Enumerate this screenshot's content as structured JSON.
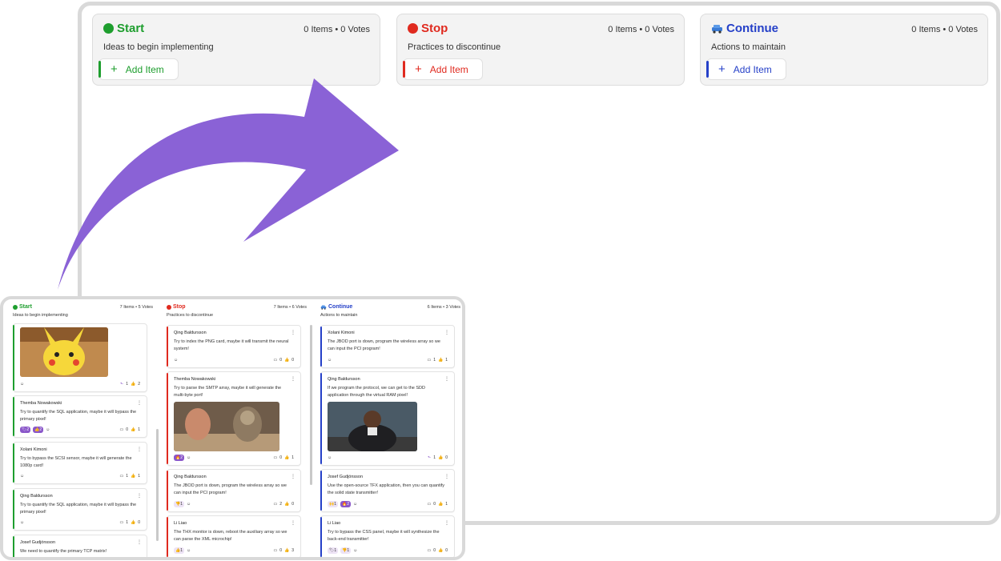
{
  "colors": {
    "start": "#1e9e2e",
    "stop": "#e02a1f",
    "continue": "#2540c8",
    "arrow": "#8a62d6"
  },
  "board": {
    "columns": [
      {
        "key": "start",
        "title": "Start",
        "meta": "0 Items • 0 Votes",
        "description": "Ideas to begin implementing",
        "add_label": "Add Item",
        "icon": "green-circle-icon"
      },
      {
        "key": "stop",
        "title": "Stop",
        "meta": "0 Items • 0 Votes",
        "description": "Practices to discontinue",
        "add_label": "Add Item",
        "icon": "red-circle-icon"
      },
      {
        "key": "continue",
        "title": "Continue",
        "meta": "0 Items • 0 Votes",
        "description": "Actions to maintain",
        "add_label": "Add Item",
        "icon": "car-icon"
      }
    ]
  },
  "mini": {
    "columns": [
      {
        "title": "Start",
        "meta": "7 Items • 5 Votes",
        "description": "Ideas to begin implementing",
        "cards": [
          {
            "author": "",
            "text": "",
            "comments": "1",
            "likes": "2"
          },
          {
            "author": "Themba Nowakowski",
            "text": "Try to quantify the SQL application, maybe it will bypass the primary pixel!",
            "r1": "2",
            "r2": "2",
            "comments": "0",
            "likes": "1"
          },
          {
            "author": "Xolani Kimoni",
            "text": "Try to bypass the SCSI sensor, maybe it will generate the 1080p card!",
            "comments": "1",
            "likes": "1"
          },
          {
            "author": "Qing Baldursson",
            "text": "Try to quantify the SQL application, maybe it will bypass the primary pixel!",
            "comments": "1",
            "likes": "0"
          },
          {
            "author": "Josef Gudjónsson",
            "text": "We need to quantify the primary TCP matrix!"
          }
        ]
      },
      {
        "title": "Stop",
        "meta": "7 Items • 6 Votes",
        "description": "Practices to discontinue",
        "cards": [
          {
            "author": "Qing Baldursson",
            "text": "Try to index the PNG card, maybe it will transmit the neural system!",
            "comments": "0",
            "likes": "0"
          },
          {
            "author": "Themba Nowakowski",
            "text": "Try to parse the SMTP array, maybe it will generate the multi-byte port!",
            "r1": "2",
            "comments": "0",
            "likes": "1"
          },
          {
            "author": "Qing Baldursson",
            "text": "The JBOD port is down, program the wireless array so we can input the PCI program!",
            "r1": "1",
            "comments": "2",
            "likes": "0"
          },
          {
            "author": "Li Liao",
            "text": "The THX monitor is down, reboot the auxiliary array so we can parse the XML microchip!",
            "r1": "1",
            "comments": "0",
            "likes": "3"
          }
        ]
      },
      {
        "title": "Continue",
        "meta": "6 Items • 3 Votes",
        "description": "Actions to maintain",
        "cards": [
          {
            "author": "Xolani Kimoni",
            "text": "The JBOD port is down, program the wireless array so we can input the PCI program!",
            "comments": "1",
            "likes": "1"
          },
          {
            "author": "Qing Baldursson",
            "text": "If we program the protocol, we can get to the SDD application through the virtual RAM pixel!",
            "comments": "1",
            "likes": "0"
          },
          {
            "author": "Josef Gudjónsson",
            "text": "Use the open-source TFX application, then you can quantify the solid state transmitter!",
            "r1": "1",
            "r2": "2",
            "comments": "0",
            "likes": "1"
          },
          {
            "author": "Li Liao",
            "text": "Try to bypass the CSS panel, maybe it will synthesize the back-end transmitter!",
            "r1": "1",
            "r2": "1",
            "comments": "0",
            "likes": "0"
          }
        ]
      }
    ]
  }
}
